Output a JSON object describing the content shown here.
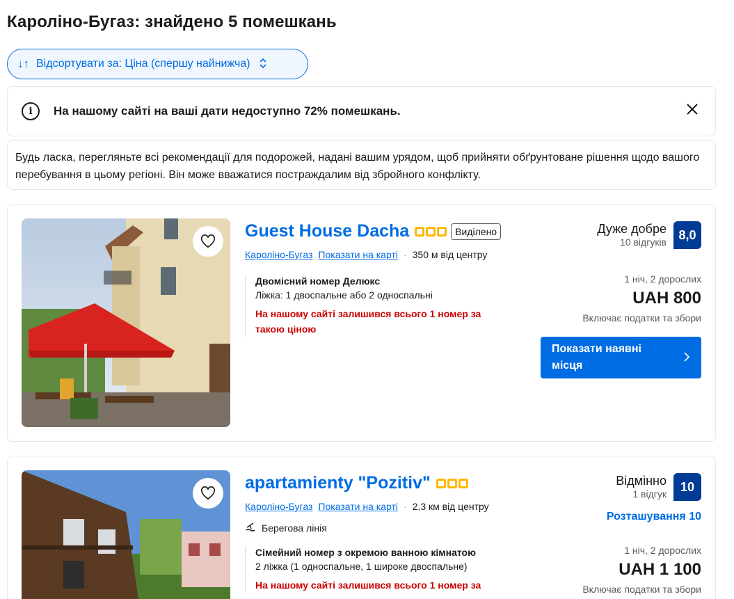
{
  "header": {
    "title": "Кароліно-Бугаз: знайдено 5 помешкань"
  },
  "sort": {
    "label": "Відсортувати за: Ціна (спершу найнижча)"
  },
  "notice": {
    "text": "На нашому сайті на ваші дати недоступно 72% помешкань."
  },
  "advisory": {
    "text": "Будь ласка, перегляньте всі рекомендації для подорожей, надані вашим урядом, щоб прийняти обґрунтоване рішення щодо вашого перебування в цьому регіоні. Він може вважатися постраждалим від збройного конфлікту."
  },
  "colors": {
    "accent": "#006ce4",
    "score_bg": "#003b95",
    "star": "#ffb700",
    "warning": "#cc0000"
  },
  "listings": [
    {
      "name": "Guest House Dacha",
      "stars": 3,
      "badge": "Виділено",
      "location": "Кароліно-Бугаз",
      "map_link": "Показати на карті",
      "distance": "350 м від центру",
      "room_name": "Двомісний номер Делюкс",
      "beds": "Ліжка: 1 двоспальне або 2 односпальні",
      "warning": "На нашому сайті залишився всього 1 номер за такою ціною",
      "rating_word": "Дуже добре",
      "reviews": "10 відгуків",
      "score": "8,0",
      "stay": "1 ніч, 2 дорослих",
      "price": "UAH 800",
      "taxes": "Включає податки та збори",
      "cta": "Показати наявні місця"
    },
    {
      "name": "apartamienty \"Pozitiv\"",
      "stars": 3,
      "location": "Кароліно-Бугаз",
      "map_link": "Показати на карті",
      "distance": "2,3 км від центру",
      "feature": "Берегова лінія",
      "room_name": "Сімейний номер з окремою ванною кімнатою",
      "beds": "2 ліжка (1 односпальне, 1 широке двоспальне)",
      "warning": "На нашому сайті залишився всього 1 номер за",
      "rating_word": "Відмінно",
      "reviews": "1 відгук",
      "score": "10",
      "location_score": "Розташування 10",
      "stay": "1 ніч, 2 дорослих",
      "price": "UAH 1 100",
      "taxes": "Включає податки та збори"
    }
  ]
}
